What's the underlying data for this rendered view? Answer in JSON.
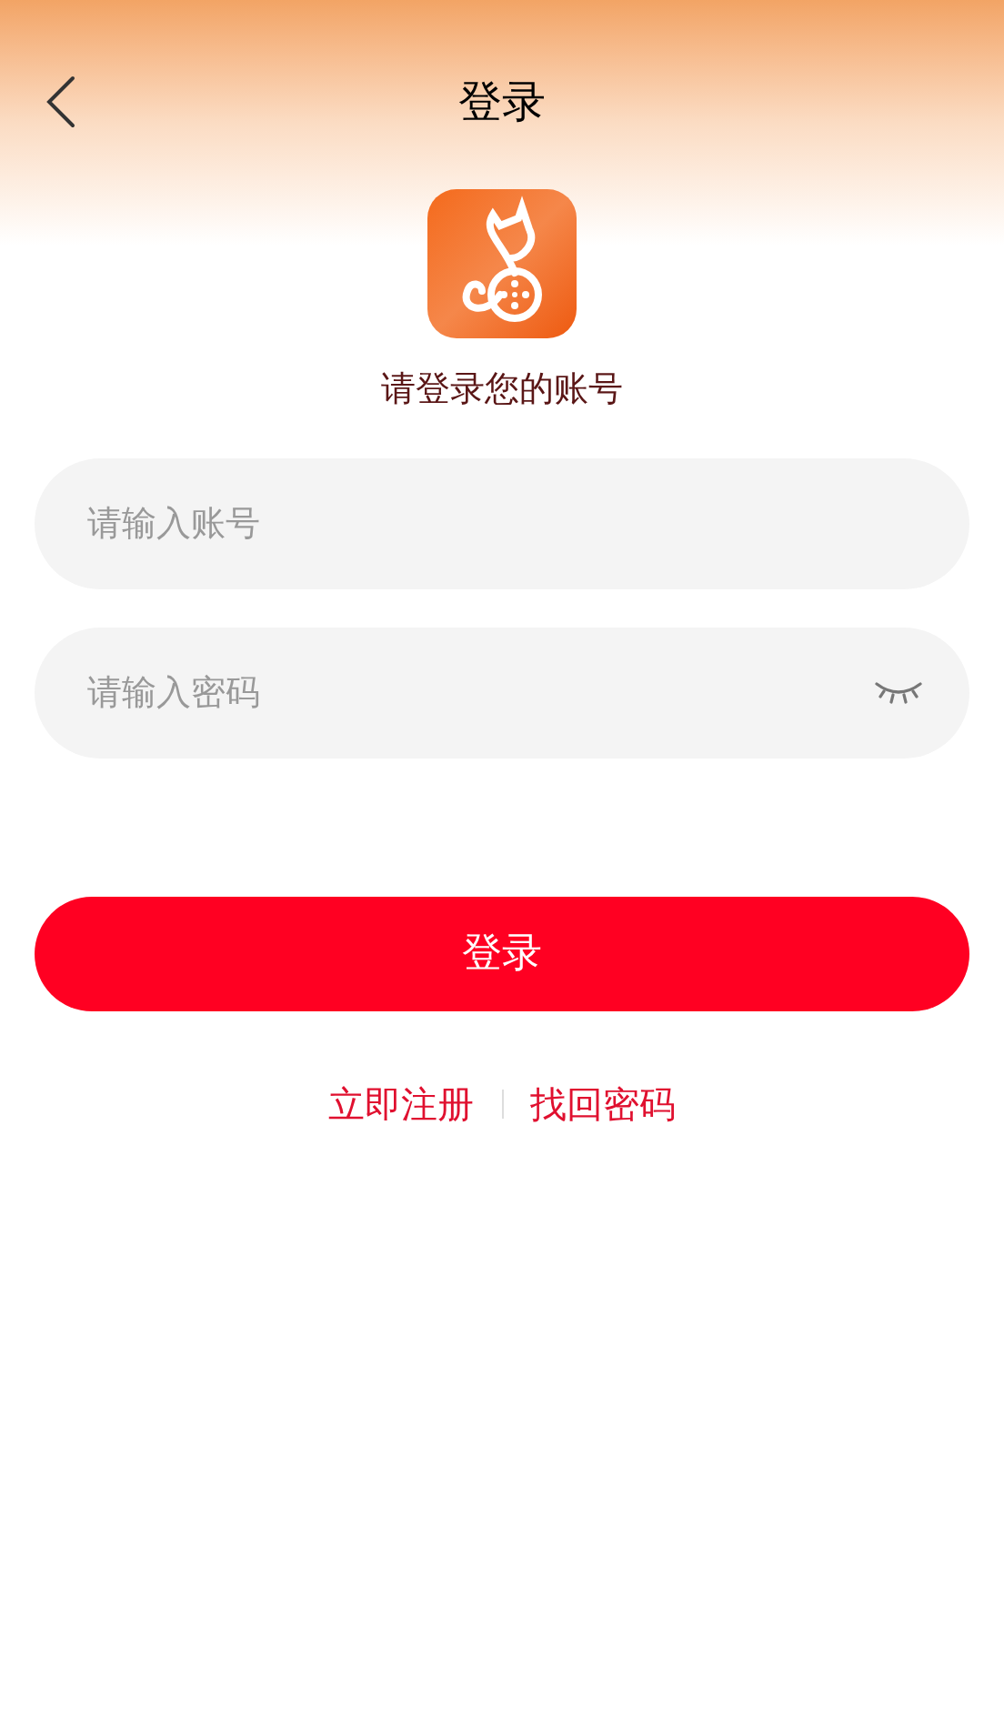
{
  "header": {
    "title": "登录"
  },
  "subtitle": "请登录您的账号",
  "fields": [
    {
      "kind": "text",
      "placeholder": "请输入账号"
    },
    {
      "kind": "password",
      "placeholder": "请输入密码",
      "masked": true
    }
  ],
  "login_button": "登录",
  "links": [
    "立即注册",
    "找回密码"
  ]
}
